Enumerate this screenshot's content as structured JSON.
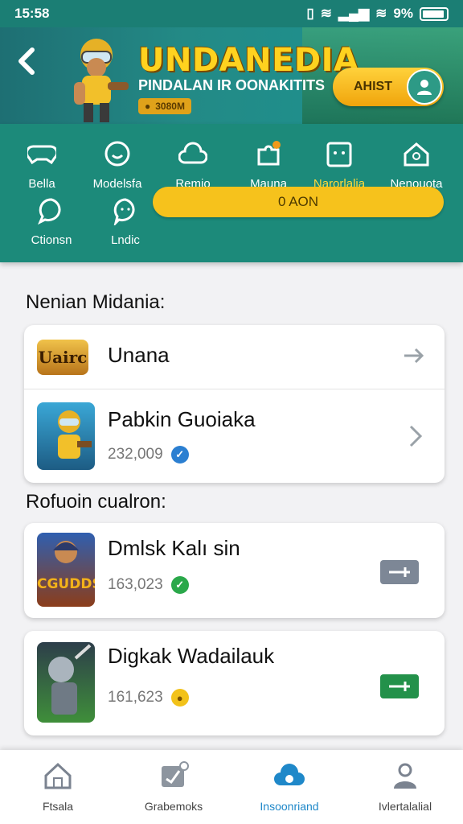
{
  "status_bar": {
    "time": "15:58",
    "battery": "9%"
  },
  "banner": {
    "title": "UNDANEDIA",
    "subtitle": "PINDALAN IR OONAKITITS",
    "chip": "3080M",
    "button_label": "AHIST"
  },
  "categories": [
    {
      "label": "Bella",
      "icon": "controller-icon"
    },
    {
      "label": "Modelsfa",
      "icon": "chat-icon"
    },
    {
      "label": "Remio",
      "icon": "cloud-icon"
    },
    {
      "label": "Mauna",
      "icon": "puzzle-icon"
    },
    {
      "label": "Narorlalia",
      "icon": "screen-icon",
      "active": true
    },
    {
      "label": "Nenouota",
      "icon": "home-icon"
    },
    {
      "label": "Ctionsn",
      "icon": "bubble-icon"
    },
    {
      "label": "Lndic",
      "icon": "speech-icon"
    }
  ],
  "category_pill": "0 AON",
  "sections": {
    "first_title": "Nenian Midania:",
    "second_title": "Rofuoin cualron:"
  },
  "list_one": [
    {
      "title": "Unana",
      "thumb_text": "Uairc"
    },
    {
      "title": "Pabkin Guoiaka",
      "meta": "232,009"
    }
  ],
  "list_two": [
    {
      "title": "Dmlsk Kalı sin",
      "meta": "163,023",
      "thumb_text": "CGUDDS"
    },
    {
      "title": "Digkak Wadailauk",
      "meta": "161,623"
    }
  ],
  "colors": {
    "teal": "#1c8a7a",
    "accent": "#f6c21c",
    "nav_active": "#1f88c9",
    "verified": "#2b7fd1",
    "ok": "#2aa84a",
    "add_gray": "#7d8796",
    "add_green": "#23914a"
  },
  "bottom_nav": [
    {
      "label": "Ftsala",
      "icon": "home-icon"
    },
    {
      "label": "Grabemoks",
      "icon": "edit-icon"
    },
    {
      "label": "Insoonriand",
      "icon": "cloud-icon",
      "active": true
    },
    {
      "label": "Ivlertalalial",
      "icon": "person-icon"
    }
  ]
}
